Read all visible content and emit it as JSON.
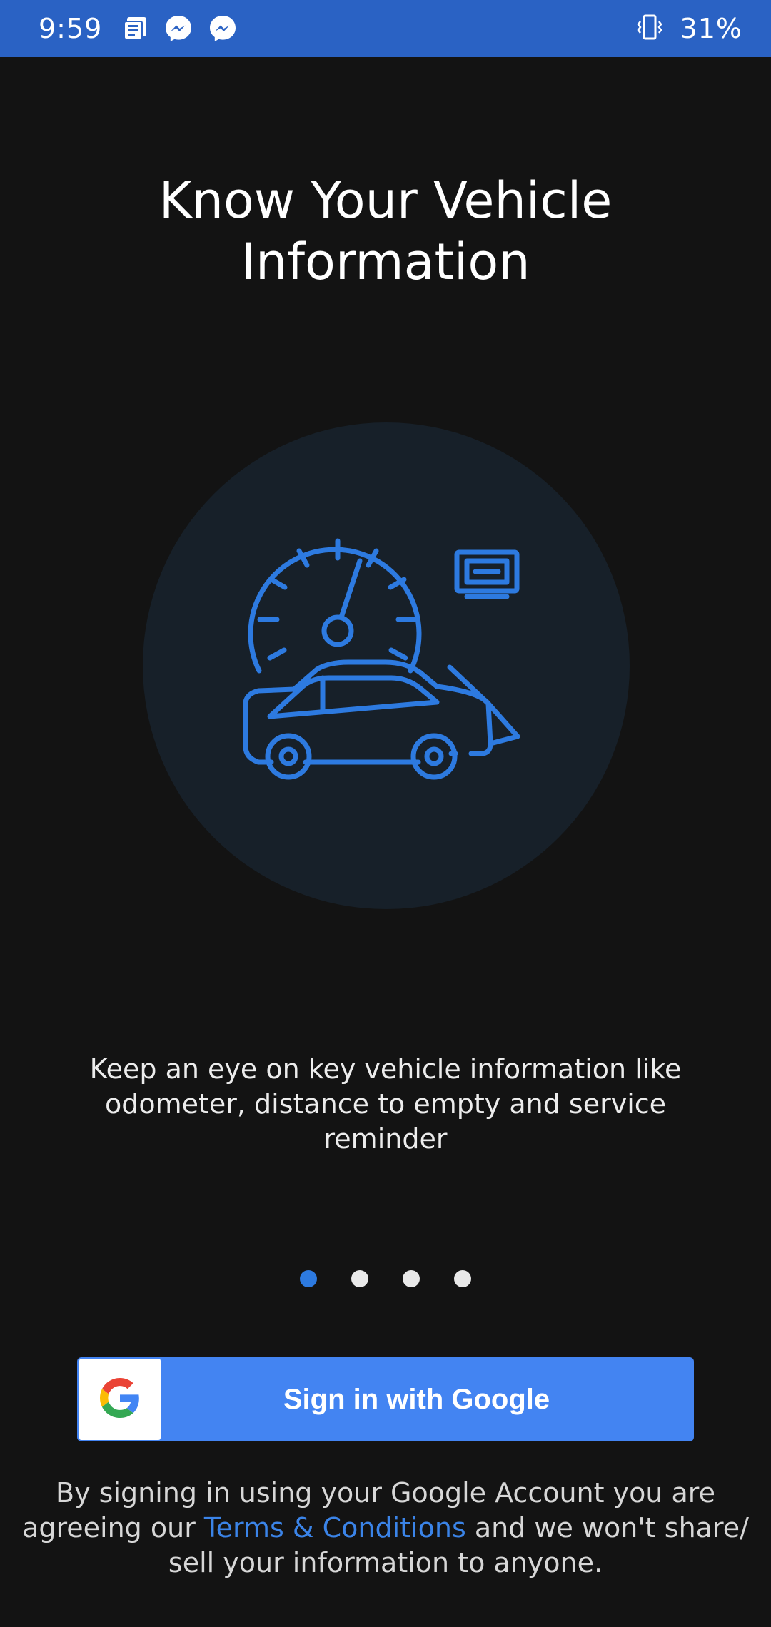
{
  "status_bar": {
    "time": "9:59",
    "notification_icons": [
      "news-icon",
      "messenger-icon",
      "messenger-icon"
    ],
    "vibrate_icon": "vibrate-icon",
    "battery": "31%",
    "background_color": "#2a62c4"
  },
  "onboarding": {
    "title": "Know Your Vehicle\nInformation",
    "illustration_icon": "car-speedometer-icon",
    "description": "Keep an eye on key vehicle information like odometer, distance to empty and service reminder",
    "pagination": {
      "current_page": 1,
      "total_pages": 4
    },
    "accent_color": "#2d7ae0"
  },
  "sign_in": {
    "button_label": "Sign in with Google",
    "button_icon": "google-g-icon",
    "button_color": "#4384f2"
  },
  "disclaimer": {
    "text_before": "By signing in using your Google Account you are agreeing our ",
    "link_text": "Terms & Conditions",
    "text_after": " and we won't share/ sell your information to anyone.",
    "link_color": "#3b84e8"
  }
}
